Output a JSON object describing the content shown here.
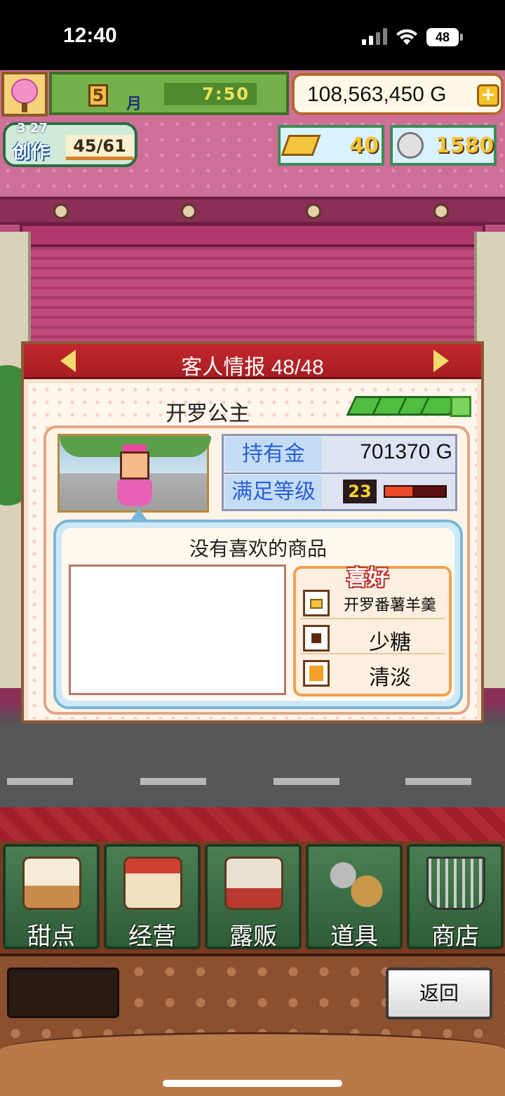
{
  "status_bar": {
    "time": "12:40",
    "battery": "48"
  },
  "hud": {
    "month": "5",
    "month_label": "月",
    "clock": "7:50",
    "money": "108,563,450 G",
    "money_add_icon": "plus-icon",
    "create_level": "3 27",
    "create_label": "创作",
    "create_count": "45/61",
    "gold_bars": "40",
    "medals": "1580"
  },
  "dialog": {
    "title": "客人情报 48/48",
    "prev_icon": "arrow-left-icon",
    "next_icon": "arrow-right-icon",
    "customer_name": "开罗公主",
    "money_label": "持有金",
    "money_value": "701370 G",
    "satisfaction_label": "满足等级",
    "satisfaction_level": "23",
    "satisfaction_fraction": 0.45,
    "bubble_message": "没有喜欢的商品",
    "preferences": {
      "title": "喜好",
      "items": [
        {
          "label": "开罗番薯羊羹",
          "icon": "yokan-icon"
        },
        {
          "label": "少糖",
          "icon": "low-sugar-icon"
        },
        {
          "label": "清淡",
          "icon": "light-flavor-icon"
        }
      ]
    }
  },
  "menu": [
    {
      "label": "甜点",
      "icon": "cake-icon"
    },
    {
      "label": "经营",
      "icon": "shop-building-icon"
    },
    {
      "label": "露贩",
      "icon": "food-truck-icon"
    },
    {
      "label": "道具",
      "icon": "items-bag-icon"
    },
    {
      "label": "商店",
      "icon": "shopping-cart-icon"
    }
  ],
  "back_button": "返回",
  "colors": {
    "header_red": "#b0232a",
    "menu_green": "#3e6e46",
    "label_blue": "#2a5fd8",
    "gold": "#f2c53d"
  }
}
